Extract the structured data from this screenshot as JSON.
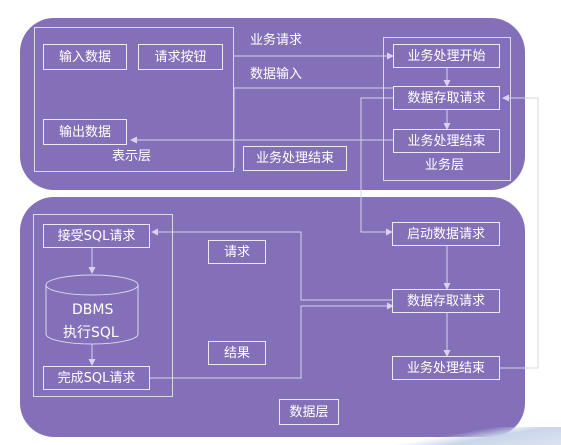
{
  "presentation": {
    "input_data": "输入数据",
    "request_button": "请求按钮",
    "output_data": "输出数据",
    "layer_label": "表示层"
  },
  "middle": {
    "business_request": "业务请求",
    "data_input": "数据输入",
    "business_end_static": "业务处理结束"
  },
  "business": {
    "start": "业务处理开始",
    "data_access": "数据存取请求",
    "end": "业务处理结束",
    "layer_label": "业务层"
  },
  "dbms_side": {
    "receive_sql": "接受SQL请求",
    "db_name": "DBMS",
    "exec_sql": "执行SQL",
    "complete_sql": "完成SQL请求",
    "request_label": "请求",
    "result_label": "结果"
  },
  "data_side": {
    "start_data_request": "启动数据请求",
    "data_access": "数据存取请求",
    "end": "业务处理结束",
    "layer_label": "数据层"
  },
  "colors": {
    "panel": "#8470b8",
    "line": "#d9d2ec",
    "box_border": "#ece8f6"
  }
}
